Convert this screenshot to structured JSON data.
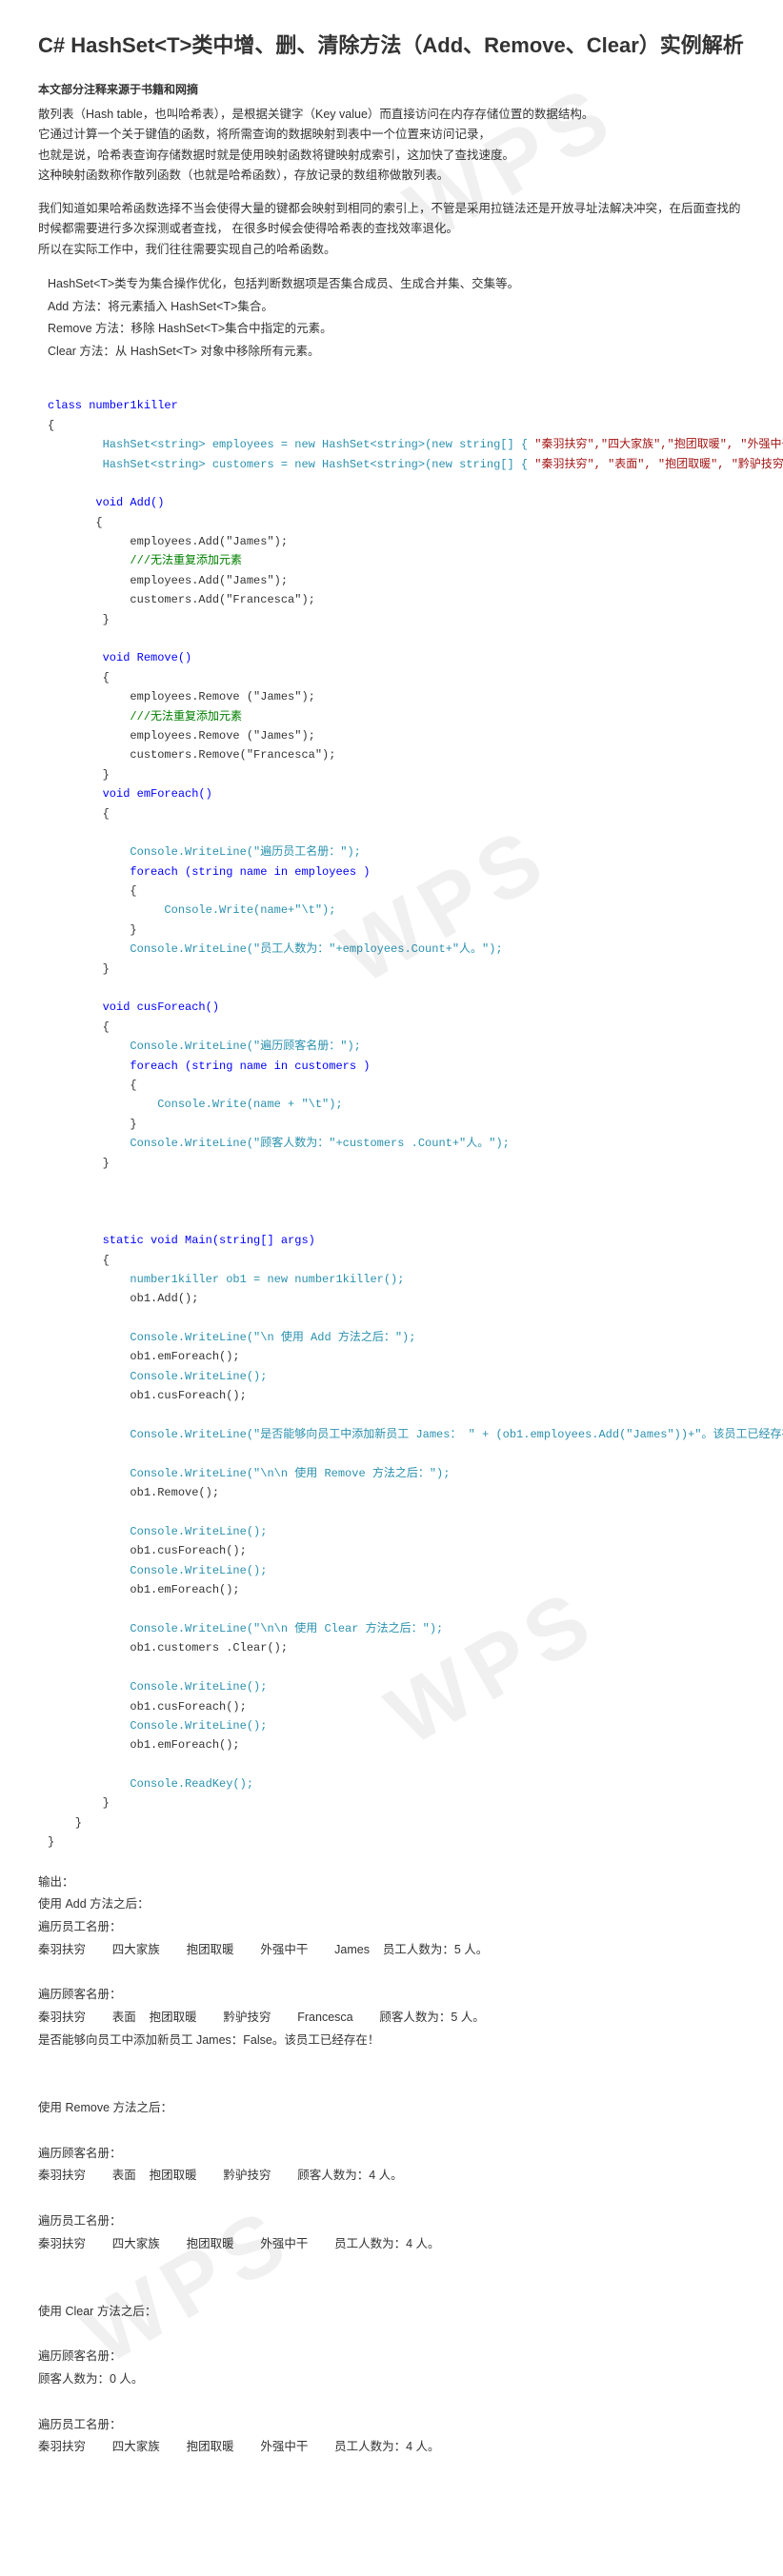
{
  "title": "C# HashSet<T>类中增、删、清除方法（Add、Remove、Clear）实例解析",
  "note": "本文部分注释来源于书籍和网摘",
  "intro": "散列表（Hash table，也叫哈希表），是根据关键字（Key value）而直接访问在内存存储位置的数据结构。\n它通过计算一个关于键值的函数，将所需查询的数据映射到表中一个位置来访问记录，\n也就是说，哈希表查询存储数据时就是使用映射函数将键映射成索引，这加快了查找速度。\n这种映射函数称作散列函数（也就是哈希函数），存放记录的数组称做散列表。",
  "para2": "我们知道如果哈希函数选择不当会使得大量的键都会映射到相同的索引上，不管是采用拉链法还是开放寻址法解决冲突，在后面查找的时候都需要进行多次探测或者查找，  在很多时候会使得哈希表的查找效率退化。\n所以在实际工作中，我们往往需要实现自己的哈希函数。",
  "concept": {
    "l1": "HashSet<T>类专为集合操作优化，包括判断数据项是否集合成员、生成合并集、交集等。",
    "l2": "Add 方法：将元素插入 HashSet<T>集合。",
    "l3": "  Remove 方法：移除 HashSet<T>集合中指定的元素。",
    "l4": "  Clear 方法：从 HashSet<T> 对象中移除所有元素。"
  },
  "code": {
    "c01": "class number1killer",
    "c02": "{",
    "c03a": "        HashSet<string> employees = new HashSet<string>(new string[] { ",
    "c03b": "\"秦羽扶穷\",\"四大家族\",\"抱团取暖\", \"外强中干\", ",
    "c03c": "});",
    "c04a": "        HashSet<string> customers = new HashSet<string>(new string[] { ",
    "c04b": "\"秦羽扶穷\", \"表面\", \"抱团取暖\", \"黔驴技穷\" ",
    "c04c": "});",
    "add_sig": "       void Add()",
    "add_b1": "       {",
    "add_l1": "            employees.Add(\"James\");",
    "add_com": "            ///无法重复添加元素",
    "add_l2": "            employees.Add(\"James\");",
    "add_l3": "            customers.Add(\"Francesca\");",
    "add_b2": "        }",
    "rem_sig": "        void Remove()",
    "rem_b1": "        {",
    "rem_l1": "            employees.Remove (\"James\");",
    "rem_com": "            ///无法重复添加元素",
    "rem_l2": "            employees.Remove (\"James\");",
    "rem_l3": "            customers.Remove(\"Francesca\");",
    "rem_b2": "        }",
    "emf_sig": "        void emForeach()",
    "emf_b1": "        {",
    "emf_w1": "            Console.WriteLine(\"遍历员工名册：\");",
    "emf_for": "            foreach (string name in employees )",
    "emf_b2": "            {",
    "emf_w2": "                 Console.Write(name+\"\\t\");",
    "emf_b3": "            }",
    "emf_w3": "            Console.WriteLine(\"员工人数为：\"+employees.Count+\"人。\");",
    "emf_b4": "        }",
    "cuf_sig": "        void cusForeach()",
    "cuf_b1": "        {",
    "cuf_w1": "            Console.WriteLine(\"遍历顾客名册：\");",
    "cuf_for": "            foreach (string name in customers )",
    "cuf_b2": "            {",
    "cuf_w2": "                Console.Write(name + \"\\t\");",
    "cuf_b3": "            }",
    "cuf_w3": "            Console.WriteLine(\"顾客人数为：\"+customers .Count+\"人。\");",
    "cuf_b4": "        }",
    "main_sig": "        static void Main(string[] args)",
    "main_b1": "        {",
    "main_l1": "            number1killer ob1 = new number1killer();",
    "main_l2": "            ob1.Add();",
    "main_l3": "            Console.WriteLine(\"\\n 使用 Add 方法之后：\");",
    "main_l4": "            ob1.emForeach();",
    "main_l5": "            Console.WriteLine();",
    "main_l6": "            ob1.cusForeach();",
    "main_l7": "            Console.WriteLine(\"是否能够向员工中添加新员工 James： \" + (ob1.employees.Add(\"James\"))+\"。该员工已经存在！\");",
    "main_l8": "            Console.WriteLine(\"\\n\\n 使用 Remove 方法之后：\");",
    "main_l9": "            ob1.Remove();",
    "main_l10": "            Console.WriteLine();",
    "main_l11": "            ob1.cusForeach();",
    "main_l12": "            Console.WriteLine();",
    "main_l13": "            ob1.emForeach();",
    "main_l14": "            Console.WriteLine(\"\\n\\n 使用 Clear 方法之后：\");",
    "main_l15": "            ob1.customers .Clear();",
    "main_l16": "            Console.WriteLine();",
    "main_l17": "            ob1.cusForeach();",
    "main_l18": "            Console.WriteLine();",
    "main_l19": "            ob1.emForeach();",
    "main_l20": "            Console.ReadKey();",
    "main_b2": "        }",
    "cls_e": "    }",
    "ns_e": "}"
  },
  "output": "输出：\n使用 Add 方法之后：\n遍历员工名册：\n秦羽扶穷        四大家族        抱团取暖        外强中干        James    员工人数为：5 人。\n\n遍历顾客名册：\n秦羽扶穷        表面    抱团取暖        黔驴技穷        Francesca        顾客人数为：5 人。\n是否能够向员工中添加新员工 James：False。该员工已经存在！\n\n\n使用 Remove 方法之后：\n\n遍历顾客名册：\n秦羽扶穷        表面    抱团取暖        黔驴技穷        顾客人数为：4 人。\n\n遍历员工名册：\n秦羽扶穷        四大家族        抱团取暖        外强中干        员工人数为：4 人。\n\n\n使用 Clear 方法之后：\n\n遍历顾客名册：\n顾客人数为：0 人。\n\n遍历员工名册：\n秦羽扶穷        四大家族        抱团取暖        外强中干        员工人数为：4 人。"
}
